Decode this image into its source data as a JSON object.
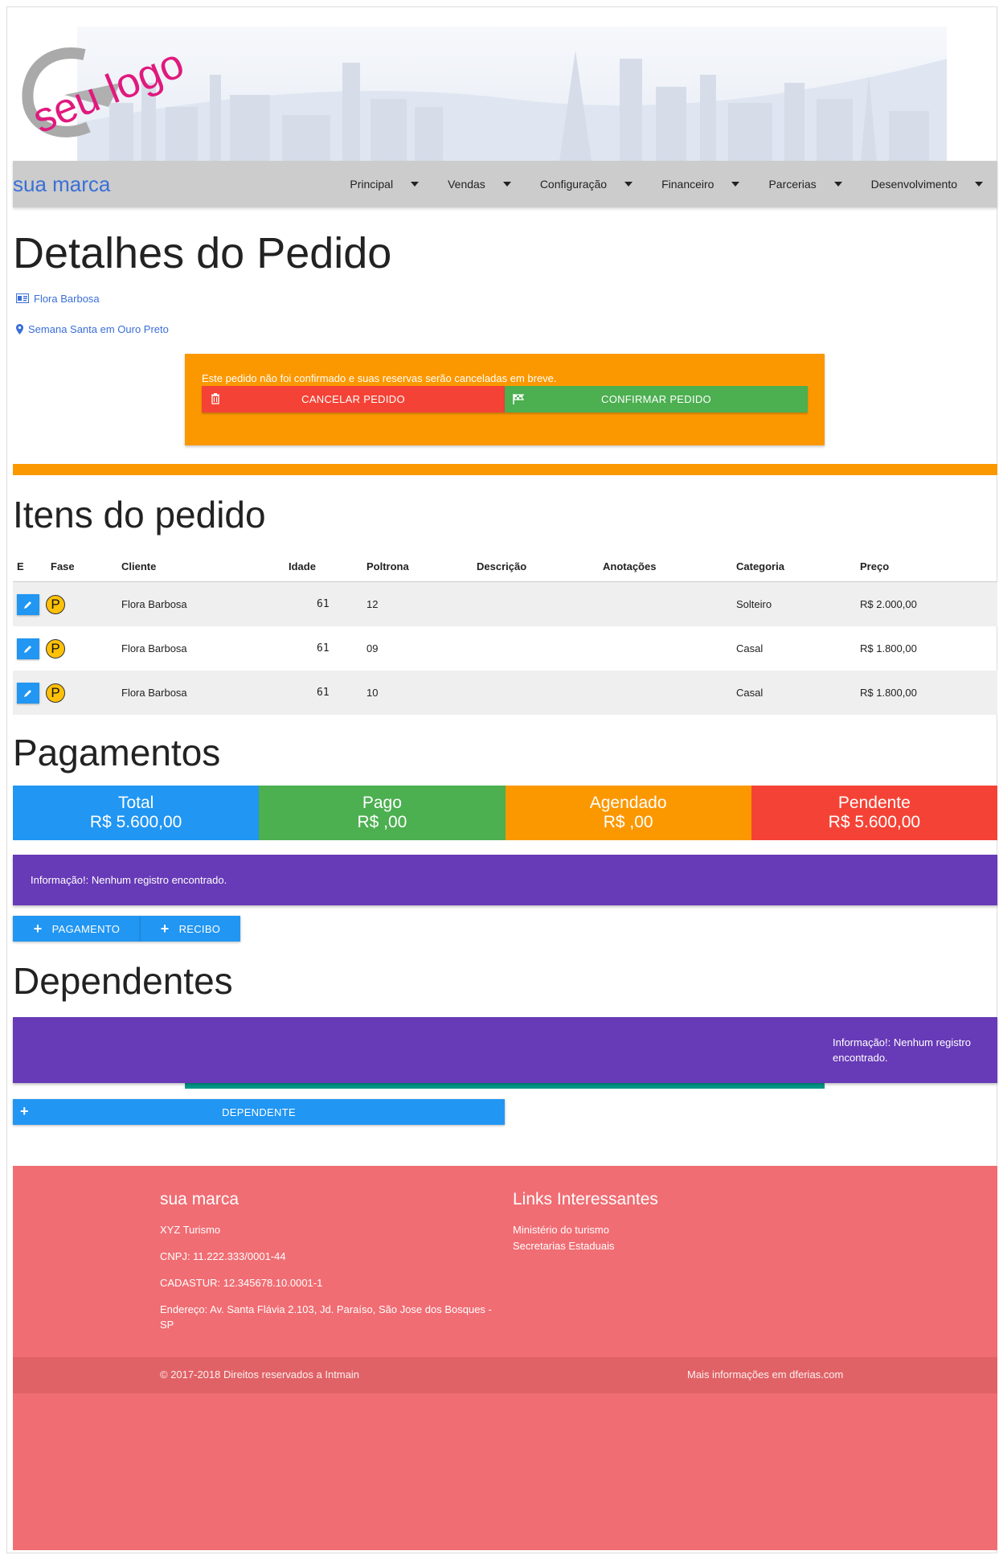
{
  "header": {
    "logo_text": "seu logo",
    "brand": "sua marca",
    "menu": [
      "Principal",
      "Vendas",
      "Configuração",
      "Financeiro",
      "Parcerias",
      "Desenvolvimento"
    ]
  },
  "order": {
    "title": "Detalhes do Pedido",
    "client_link": "Flora Barbosa",
    "trip_link": "Semana Santa em Ouro Preto",
    "alert_text": "Este pedido não foi confirmado e suas reservas serão canceladas em breve.",
    "cancel_label": "CANCELAR PEDIDO",
    "confirm_label": "CONFIRMAR PEDIDO"
  },
  "items": {
    "title": "Itens do pedido",
    "columns": [
      "E",
      "Fase",
      "Cliente",
      "Idade",
      "Poltrona",
      "Descrição",
      "Anotações",
      "Categoria",
      "Preço"
    ],
    "rows": [
      {
        "fase": "P",
        "cliente": "Flora Barbosa",
        "idade": "61",
        "poltrona": "12",
        "descricao": "",
        "anotacoes": "",
        "categoria": "Solteiro",
        "preco": "R$ 2.000,00"
      },
      {
        "fase": "P",
        "cliente": "Flora Barbosa",
        "idade": "61",
        "poltrona": "09",
        "descricao": "",
        "anotacoes": "",
        "categoria": "Casal",
        "preco": "R$ 1.800,00"
      },
      {
        "fase": "P",
        "cliente": "Flora Barbosa",
        "idade": "61",
        "poltrona": "10",
        "descricao": "",
        "anotacoes": "",
        "categoria": "Casal",
        "preco": "R$ 1.800,00"
      }
    ]
  },
  "payments": {
    "title": "Pagamentos",
    "totals": [
      {
        "label": "Total",
        "value": "R$ 5.600,00",
        "color": "#2196f3"
      },
      {
        "label": "Pago",
        "value": "R$ ,00",
        "color": "#4caf50"
      },
      {
        "label": "Agendado",
        "value": "R$ ,00",
        "color": "#fb9800"
      },
      {
        "label": "Pendente",
        "value": "R$ 5.600,00",
        "color": "#f44336"
      }
    ],
    "info": "Informação!: Nenhum registro encontrado.",
    "btn_payment": "PAGAMENTO",
    "btn_receipt": "RECIBO"
  },
  "dependents": {
    "title": "Dependentes",
    "info": "Informação!: Nenhum registro encontrado.",
    "btn_add": "DEPENDENTE"
  },
  "footer": {
    "brand": "sua marca",
    "company": "XYZ Turismo",
    "cnpj": "CNPJ: 11.222.333/0001-44",
    "cadastur": "CADASTUR: 12.345678.10.0001-1",
    "address": "Endereço: Av. Santa Flávia 2.103, Jd. Paraíso, São Jose dos Bosques - SP",
    "links_title": "Links Interessantes",
    "links": [
      "Ministério do turismo",
      "Secretarias Estaduais"
    ],
    "copyright": "© 2017-2018 Direitos reservados a Intmain",
    "more_info": "Mais informações em dferias.com"
  },
  "colors": {
    "brand_blue": "#3a6fd8",
    "orange": "#fb9800",
    "purple": "#673ab7",
    "footer_bg": "#f06d73"
  }
}
